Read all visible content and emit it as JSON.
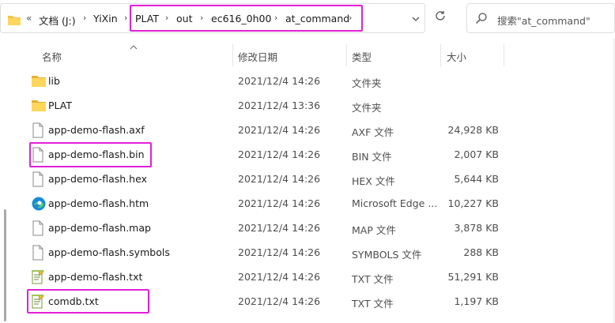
{
  "address_bar": {
    "overflow": "«",
    "crumbs": [
      "文档 (J:)",
      "YiXin",
      "PLAT",
      "out",
      "ec616_0h00",
      "at_command"
    ],
    "refresh_icon": "refresh-icon",
    "dropdown_icon": "chevron-down-icon"
  },
  "search": {
    "placeholder": "搜索\"at_command\""
  },
  "columns": {
    "name": "名称",
    "date": "修改日期",
    "type": "类型",
    "size": "大小"
  },
  "files": [
    {
      "name": "lib",
      "date": "2021/12/4 14:26",
      "type": "文件夹",
      "size": "",
      "icon": "folder-icon"
    },
    {
      "name": "PLAT",
      "date": "2021/12/4 13:36",
      "type": "文件夹",
      "size": "",
      "icon": "folder-icon"
    },
    {
      "name": "app-demo-flash.axf",
      "date": "2021/12/4 14:26",
      "type": "AXF 文件",
      "size": "24,928 KB",
      "icon": "file-icon"
    },
    {
      "name": "app-demo-flash.bin",
      "date": "2021/12/4 14:26",
      "type": "BIN 文件",
      "size": "2,007 KB",
      "icon": "file-icon"
    },
    {
      "name": "app-demo-flash.hex",
      "date": "2021/12/4 14:26",
      "type": "HEX 文件",
      "size": "5,644 KB",
      "icon": "file-icon"
    },
    {
      "name": "app-demo-flash.htm",
      "date": "2021/12/4 14:26",
      "type": "Microsoft Edge ...",
      "size": "10,227 KB",
      "icon": "edge-icon"
    },
    {
      "name": "app-demo-flash.map",
      "date": "2021/12/4 14:26",
      "type": "MAP 文件",
      "size": "3,878 KB",
      "icon": "file-icon"
    },
    {
      "name": "app-demo-flash.symbols",
      "date": "2021/12/4 14:26",
      "type": "SYMBOLS 文件",
      "size": "288 KB",
      "icon": "file-icon"
    },
    {
      "name": "app-demo-flash.txt",
      "date": "2021/12/4 14:26",
      "type": "TXT 文件",
      "size": "51,291 KB",
      "icon": "text-file-icon"
    },
    {
      "name": "comdb.txt",
      "date": "2021/12/4 14:26",
      "type": "TXT 文件",
      "size": "1,197 KB",
      "icon": "text-file-icon"
    }
  ],
  "colors": {
    "highlight": "#e21fd8",
    "folder": "#f6c445",
    "edge": "#1a8bd6"
  }
}
